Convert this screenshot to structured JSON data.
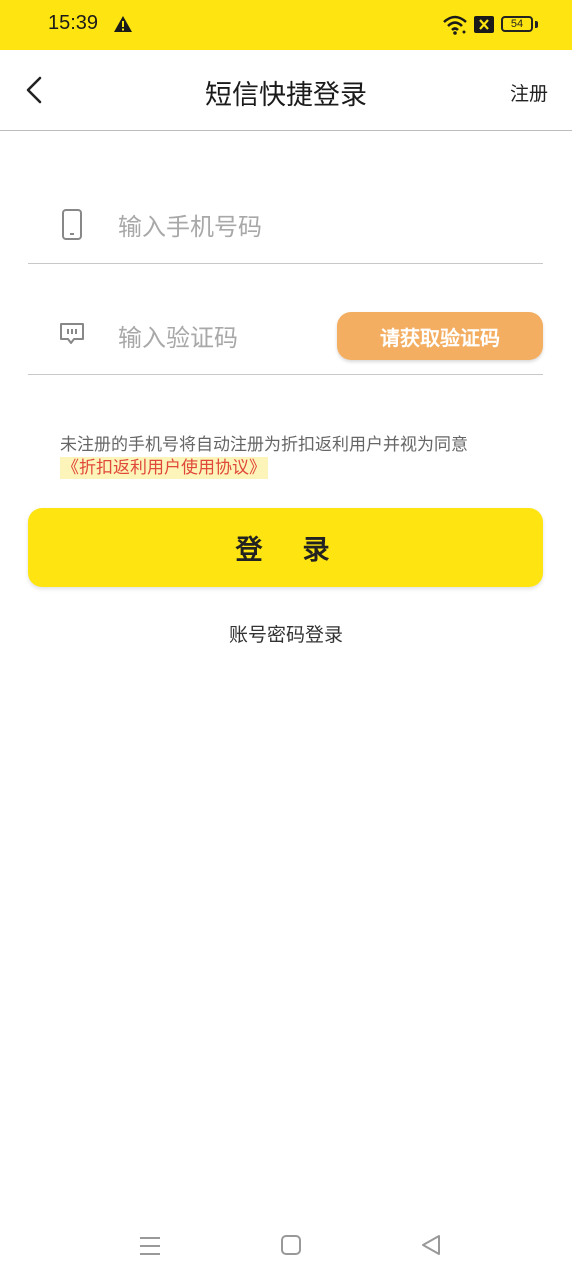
{
  "status_bar": {
    "time": "15:39",
    "battery": "54",
    "icons": [
      "warning-icon",
      "wifi-icon",
      "sim-off-icon",
      "battery-icon"
    ]
  },
  "header": {
    "title": "短信快捷登录",
    "register_label": "注册"
  },
  "form": {
    "phone_placeholder": "输入手机号码",
    "phone_value": "",
    "code_placeholder": "输入验证码",
    "code_value": "",
    "get_code_label": "请获取验证码"
  },
  "agreement": {
    "text": "未注册的手机号将自动注册为折扣返利用户并视为同意",
    "link": "《折扣返利用户使用协议》"
  },
  "login_label": "登录",
  "password_login_label": "账号密码登录",
  "colors": {
    "brand_yellow": "#FEE511",
    "code_button": "#F4AE62",
    "link_red": "#E0483A"
  }
}
